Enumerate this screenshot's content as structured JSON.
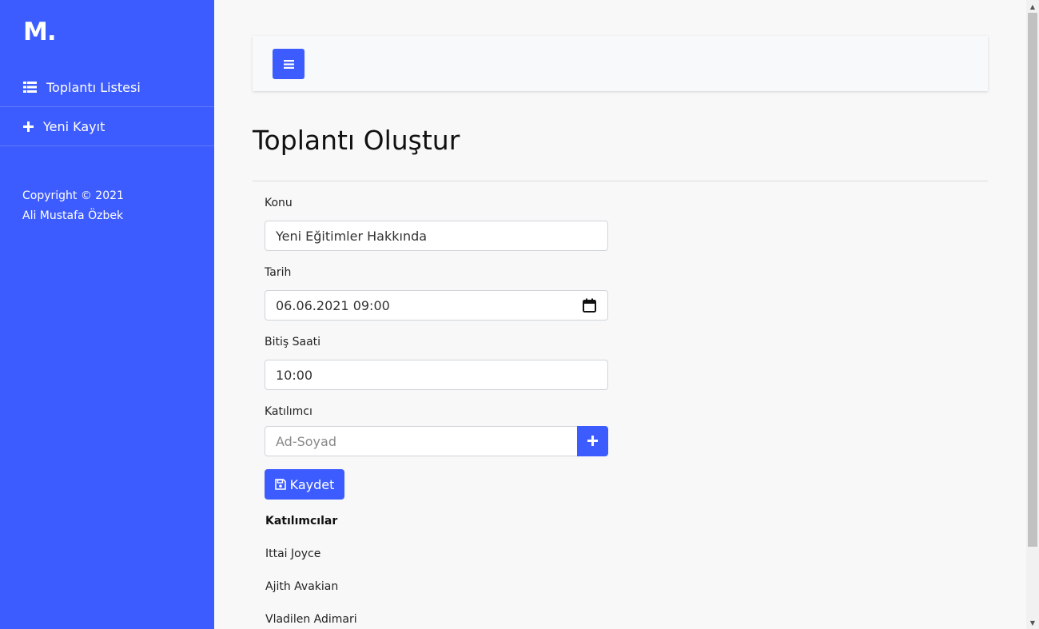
{
  "sidebar": {
    "logo": "M.",
    "items": [
      {
        "label": "Toplantı Listesi",
        "icon": "list-icon"
      },
      {
        "label": "Yeni Kayıt",
        "icon": "plus-icon"
      }
    ],
    "footer": {
      "line1": "Copyright © 2021",
      "line2": "Ali Mustafa Özbek"
    }
  },
  "header": {
    "menu_icon": "hamburger-icon"
  },
  "page": {
    "title": "Toplantı Oluştur"
  },
  "form": {
    "subject": {
      "label": "Konu",
      "value": "Yeni Eğitimler Hakkında"
    },
    "date": {
      "label": "Tarih",
      "value": "06.06.2021 09:00",
      "icon": "calendar-icon"
    },
    "end_time": {
      "label": "Bitiş Saati",
      "value": "10:00"
    },
    "participant": {
      "label": "Katılımcı",
      "placeholder": "Ad-Soyad",
      "add_icon": "plus-icon"
    },
    "save_label": "Kaydet",
    "save_icon": "floppy-disk-icon"
  },
  "participants": {
    "title": "Katılımcılar",
    "items": [
      "Ittai Joyce",
      "Ajith Avakian",
      "Vladilen Adimari"
    ]
  },
  "colors": {
    "primary": "#3d5cff",
    "background": "#f8f8f8"
  }
}
